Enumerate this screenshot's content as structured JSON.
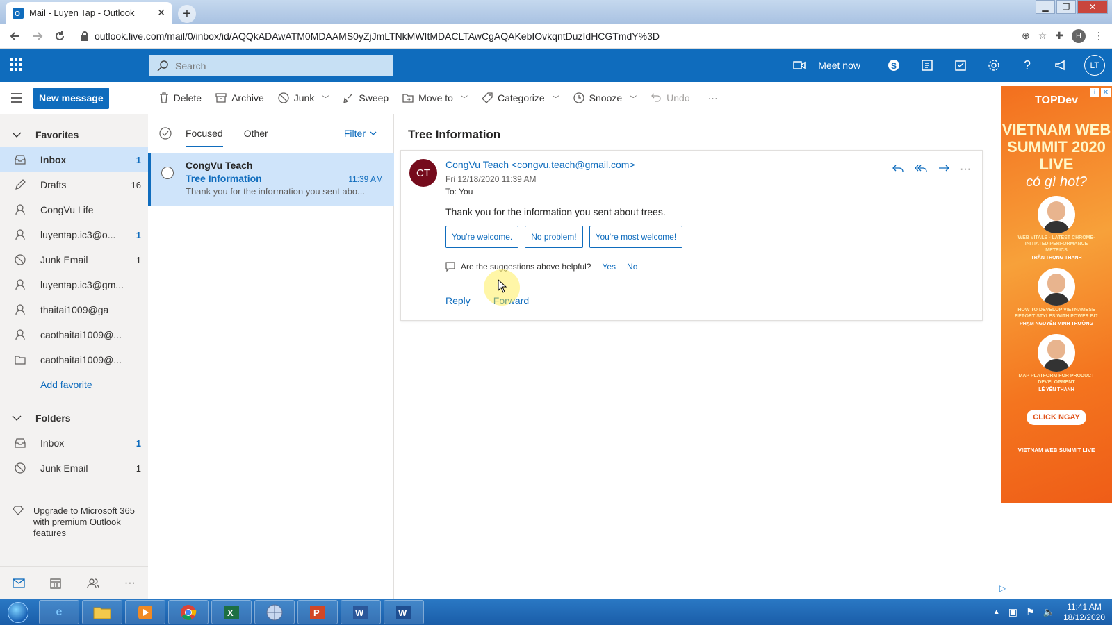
{
  "browser": {
    "tab_title": "Mail - Luyen Tap - Outlook",
    "url": "outlook.live.com/mail/0/inbox/id/AQQkADAwATM0MDAAMS0yZjJmLTNkMWItMDACLTAwCgAQAKebIOvkqntDuzIdHCGTmdY%3D",
    "profile_initial": "H"
  },
  "header": {
    "search_placeholder": "Search",
    "meet_now": "Meet now",
    "account_initials": "LT"
  },
  "toolbar": {
    "new_message": "New message",
    "delete": "Delete",
    "archive": "Archive",
    "junk": "Junk",
    "sweep": "Sweep",
    "move_to": "Move to",
    "categorize": "Categorize",
    "snooze": "Snooze",
    "undo": "Undo",
    "more": "···"
  },
  "sidebar": {
    "favorites_label": "Favorites",
    "favorites": [
      {
        "label": "Inbox",
        "count": "1",
        "icon": "inbox-icon"
      },
      {
        "label": "Drafts",
        "count": "16",
        "icon": "pencil-icon"
      },
      {
        "label": "CongVu Life",
        "count": "",
        "icon": "person-icon"
      },
      {
        "label": "luyentap.ic3@o...",
        "count": "1",
        "icon": "person-icon"
      },
      {
        "label": "Junk Email",
        "count": "1",
        "icon": "blocked-icon"
      },
      {
        "label": "luyentap.ic3@gm...",
        "count": "",
        "icon": "person-icon"
      },
      {
        "label": "thaitai1009@ga",
        "count": "",
        "icon": "person-icon"
      },
      {
        "label": "caothaitai1009@...",
        "count": "",
        "icon": "person-icon"
      },
      {
        "label": "caothaitai1009@...",
        "count": "",
        "icon": "folder-icon"
      }
    ],
    "add_favorite": "Add favorite",
    "folders_label": "Folders",
    "folders": [
      {
        "label": "Inbox",
        "count": "1",
        "icon": "inbox-icon"
      },
      {
        "label": "Junk Email",
        "count": "1",
        "icon": "blocked-icon"
      }
    ],
    "upgrade_text": "Upgrade to Microsoft 365 with premium Outlook features"
  },
  "message_list": {
    "tabs": [
      "Focused",
      "Other"
    ],
    "filter": "Filter",
    "items": [
      {
        "sender": "CongVu Teach",
        "subject": "Tree Information",
        "time": "11:39 AM",
        "preview": "Thank you for the information you sent abo..."
      }
    ]
  },
  "reading_pane": {
    "title": "Tree Information",
    "avatar_initials": "CT",
    "from": "CongVu Teach <congvu.teach@gmail.com>",
    "date": "Fri 12/18/2020 11:39 AM",
    "to": "To:  You",
    "body": "Thank you for the information you sent about trees.",
    "suggestions": [
      "You're welcome.",
      "No problem!",
      "You're most welcome!"
    ],
    "helpful_question": "Are the suggestions above helpful?",
    "yes": "Yes",
    "no": "No",
    "reply": "Reply",
    "forward": "Forward"
  },
  "ad": {
    "brand": "TOPDev",
    "headline": "VIETNAM WEB SUMMIT 2020 LIVE",
    "tagline": "có gì hot?",
    "talks": [
      "WEB VITALS - LATEST CHROME-INITIATED PERFORMANCE METRICS",
      "HOW TO DEVELOP VIETNAMESE REPORT STYLES WITH POWER BI?",
      "MAP PLATFORM FOR PRODUCT DEVELOPMENT"
    ],
    "speakers": [
      "TRẦN TRỌNG THANH",
      "PHẠM NGUYỄN MINH TRƯỜNG",
      "LÊ YÊN THANH"
    ],
    "cta": "CLICK NGAY",
    "footer": "VIETNAM WEB SUMMIT LIVE"
  },
  "taskbar": {
    "time": "11:41 AM",
    "date": "18/12/2020"
  },
  "colors": {
    "outlook_blue": "#0f6cbd",
    "selected_bg": "#cfe4fa",
    "avatar_ct": "#750b1c"
  }
}
